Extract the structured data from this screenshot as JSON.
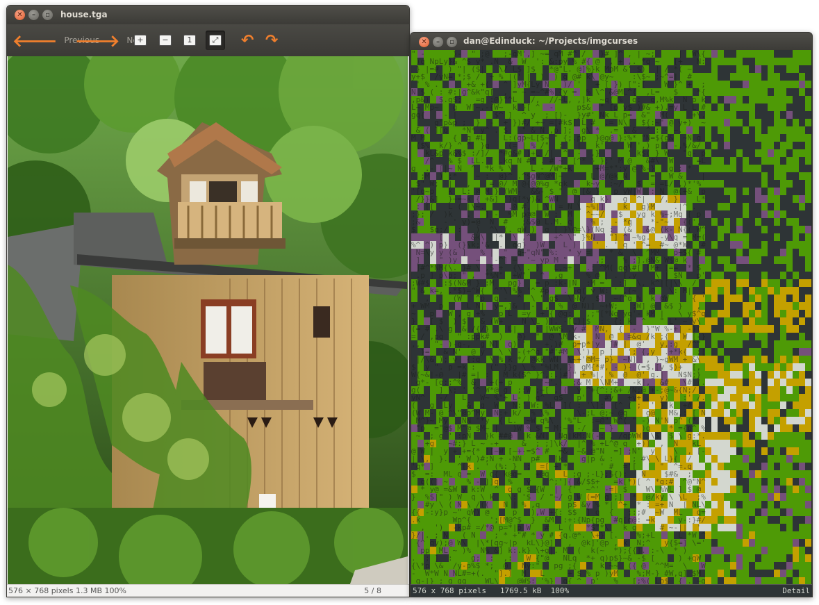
{
  "viewer": {
    "title": "house.tga",
    "toolbar": {
      "previous_label": "Previous",
      "next_label": "Next"
    },
    "icons": [
      "window-close-icon",
      "window-minimize-icon",
      "window-maximize-icon",
      "arrow-left-icon",
      "arrow-right-icon",
      "zoom-in-icon",
      "zoom-out-icon",
      "zoom-normal-icon",
      "zoom-fit-icon",
      "rotate-left-icon",
      "rotate-right-icon"
    ],
    "status": {
      "info": "576 × 768 pixels  1.3 MB   100%",
      "position": "5 / 8"
    }
  },
  "terminal": {
    "title": "dan@Edinduck: ~/Projects/imgcurses",
    "status": {
      "info": "576 x 768 pixels   1769.5 kB  100%",
      "mode": "Detail"
    },
    "palette": {
      "green": "#4e9a06",
      "yellow": "#c4a000",
      "purple": "#75507b",
      "white": "#d3d7cf",
      "dark": "#2e3436"
    }
  },
  "colors": {
    "accent_orange": "#f07f2d",
    "titlebar": "#3c3b37",
    "close_button": "#e05a28"
  }
}
